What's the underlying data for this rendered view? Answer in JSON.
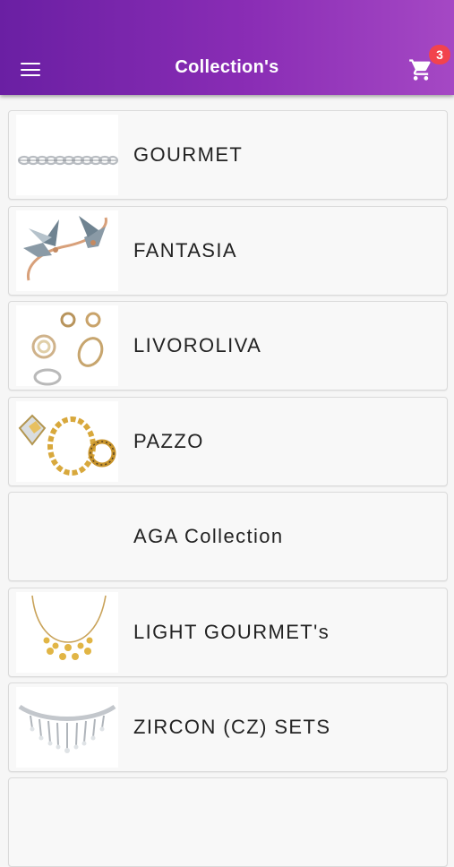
{
  "header": {
    "title": "Collection's",
    "cart_count": "3",
    "menu_icon": "hamburger-menu-icon",
    "cart_icon": "shopping-cart-icon",
    "accent_start": "#6a1fa3",
    "accent_end": "#a548c4",
    "badge_color": "#f2434d"
  },
  "collections": [
    {
      "name": "GOURMET",
      "image": "silver-chain"
    },
    {
      "name": "FANTASIA",
      "image": "bird-bangle"
    },
    {
      "name": "LIVOROLIVA",
      "image": "rings-set"
    },
    {
      "name": "PAZZO",
      "image": "gold-chain-set"
    },
    {
      "name": "AGA Collection",
      "image": ""
    },
    {
      "name": "LIGHT GOURMET's",
      "image": "gold-necklace"
    },
    {
      "name": "ZIRCON (CZ) SETS",
      "image": "cz-necklace"
    },
    {
      "name": "",
      "image": ""
    }
  ]
}
